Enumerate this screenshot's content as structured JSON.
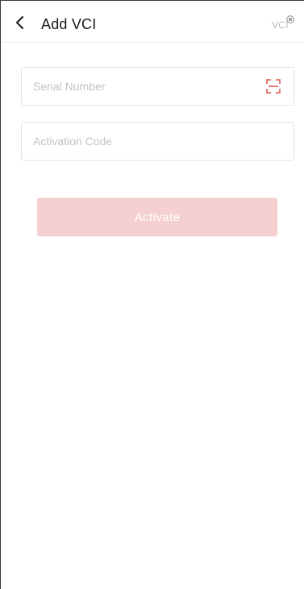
{
  "header": {
    "title": "Add VCI",
    "back_icon": "chevron-left-icon",
    "vci_badge": {
      "label": "VCI",
      "icon": "close-circle-icon"
    }
  },
  "form": {
    "serial_number": {
      "value": "",
      "placeholder": "Serial Number",
      "scan_icon": "scan-icon"
    },
    "activation_code": {
      "value": "",
      "placeholder": "Activation Code"
    },
    "activate_button": {
      "label": "Activate"
    }
  },
  "colors": {
    "accent_disabled": "#f5d0d0",
    "scan_icon": "#e05a4f",
    "title_text": "#1a1a1a",
    "placeholder_text": "#c2c2c2",
    "border": "#e4e4e4"
  }
}
